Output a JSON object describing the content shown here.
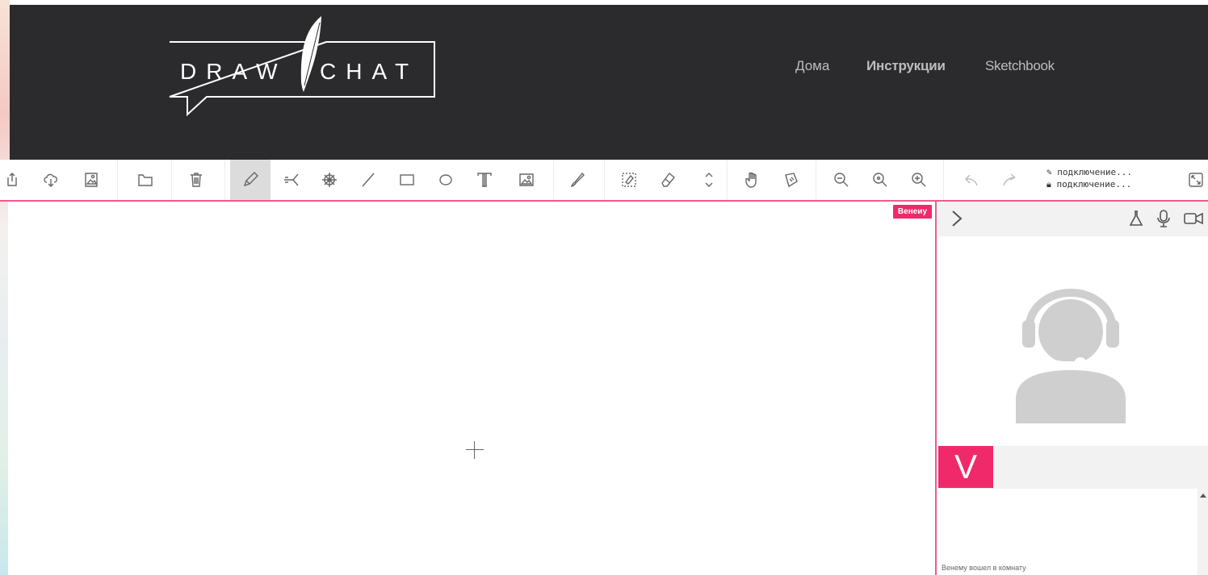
{
  "header": {
    "logo_left": "DRAW",
    "logo_right": "CHAT",
    "nav": [
      {
        "label": "Дома"
      },
      {
        "label": "Инструкции"
      },
      {
        "label": "Sketchbook"
      }
    ]
  },
  "toolbar": {
    "status": [
      {
        "icon": "pencil-icon",
        "text": "подключение..."
      },
      {
        "icon": "lock-icon",
        "text": "подключение..."
      }
    ]
  },
  "canvas": {
    "user_tag": "Венеиу"
  },
  "side": {
    "user_initial": "V",
    "chat_message": "Венему вошел в комнату"
  },
  "colors": {
    "header_bg": "#2b2b2d",
    "accent": "#f0296a",
    "canvas_border": "#f05a8c",
    "panel_bg": "#f2f2f2"
  }
}
